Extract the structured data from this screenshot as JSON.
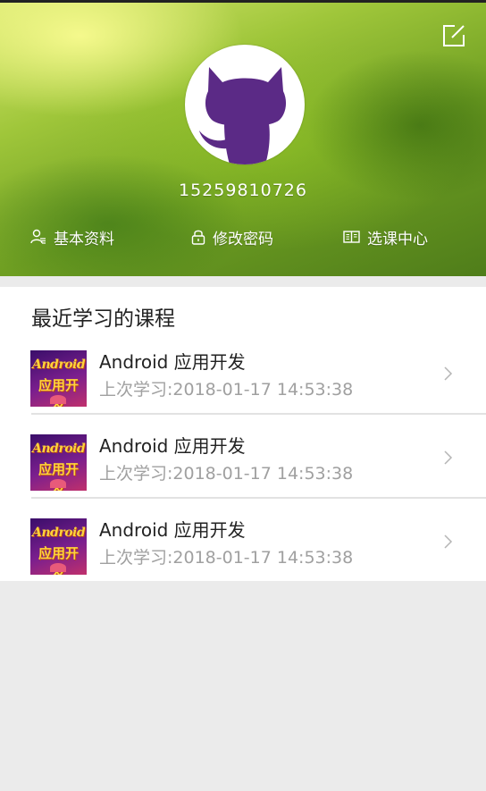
{
  "profile": {
    "phone": "15259810726"
  },
  "menu": {
    "profile_label": "基本资料",
    "password_label": "修改密码",
    "courses_label": "选课中心"
  },
  "recent": {
    "title": "最近学习的课程",
    "courses": [
      {
        "name": "Android 应用开发",
        "last_study": "上次学习:2018-01-17 14:53:38",
        "thumb_line1": "Android",
        "thumb_line2": "应用开发"
      },
      {
        "name": "Android 应用开发",
        "last_study": "上次学习:2018-01-17 14:53:38",
        "thumb_line1": "Android",
        "thumb_line2": "应用开发"
      },
      {
        "name": "Android 应用开发",
        "last_study": "上次学习:2018-01-17 14:53:38",
        "thumb_line1": "Android",
        "thumb_line2": "应用开发"
      }
    ]
  },
  "icons": {
    "edit": "edit-icon",
    "avatar": "github-octocat-avatar",
    "profile": "user-icon",
    "password": "lock-icon",
    "courses": "book-icon",
    "chevron": "chevron-right-icon"
  },
  "colors": {
    "avatar_purple": "#5b2a86",
    "text_dark": "#222222",
    "text_muted": "#a0a0a0",
    "background": "#ebebeb"
  }
}
